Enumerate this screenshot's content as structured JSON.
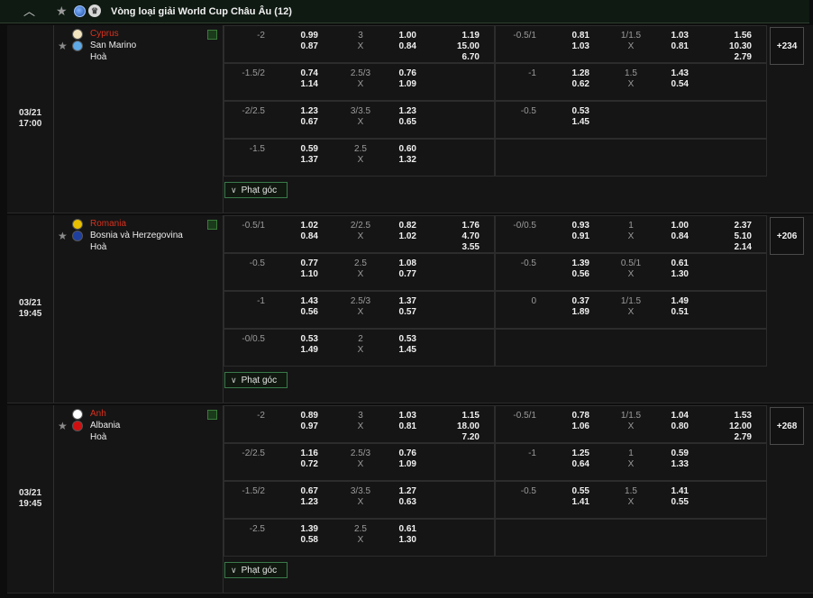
{
  "league": {
    "title": "Vòng loại giải World Cup Châu Âu (12)",
    "cup_icon": "cup-icon"
  },
  "corner_label": "Phạt góc",
  "matches": [
    {
      "date": "03/21",
      "time": "17:00",
      "home": "Cyprus",
      "away": "San Marino",
      "draw": "Hoà",
      "home_flag_color": "#f3e4c0",
      "away_flag_color": "#5fa8e6",
      "more": "+234",
      "first_1x2": [
        "1.19",
        "15.00",
        "6.70"
      ],
      "second_1x2": [
        "1.56",
        "10.30",
        "2.79"
      ],
      "rows": [
        {
          "h1": "-2",
          "o1a": "0.99",
          "o1b": "0.87",
          "t1": "3",
          "t1b": "X",
          "p1a": "1.00",
          "p1b": "0.84",
          "h2": "-0.5/1",
          "o2a": "0.81",
          "o2b": "1.03",
          "t2": "1/1.5",
          "t2b": "X",
          "p2a": "1.03",
          "p2b": "0.81"
        },
        {
          "h1": "-1.5/2",
          "o1a": "0.74",
          "o1b": "1.14",
          "t1": "2.5/3",
          "t1b": "X",
          "p1a": "0.76",
          "p1b": "1.09",
          "h2": "-1",
          "o2a": "1.28",
          "o2b": "0.62",
          "t2": "1.5",
          "t2b": "X",
          "p2a": "1.43",
          "p2b": "0.54"
        },
        {
          "h1": "-2/2.5",
          "o1a": "1.23",
          "o1b": "0.67",
          "t1": "3/3.5",
          "t1b": "X",
          "p1a": "1.23",
          "p1b": "0.65",
          "h2": "-0.5",
          "o2a": "0.53",
          "o2b": "1.45",
          "t2": "",
          "t2b": "",
          "p2a": "",
          "p2b": ""
        },
        {
          "h1": "-1.5",
          "o1a": "0.59",
          "o1b": "1.37",
          "t1": "2.5",
          "t1b": "X",
          "p1a": "0.60",
          "p1b": "1.32",
          "h2": "",
          "o2a": "",
          "o2b": "",
          "t2": "",
          "t2b": "",
          "p2a": "",
          "p2b": ""
        }
      ]
    },
    {
      "date": "03/21",
      "time": "19:45",
      "home": "Romania",
      "away": "Bosnia và Herzegovina",
      "draw": "Hoà",
      "home_flag_color": "#e8c000",
      "away_flag_color": "#1f3f9f",
      "more": "+206",
      "first_1x2": [
        "1.76",
        "4.70",
        "3.55"
      ],
      "second_1x2": [
        "2.37",
        "5.10",
        "2.14"
      ],
      "rows": [
        {
          "h1": "-0.5/1",
          "o1a": "1.02",
          "o1b": "0.84",
          "t1": "2/2.5",
          "t1b": "X",
          "p1a": "0.82",
          "p1b": "1.02",
          "h2": "-0/0.5",
          "o2a": "0.93",
          "o2b": "0.91",
          "t2": "1",
          "t2b": "X",
          "p2a": "1.00",
          "p2b": "0.84"
        },
        {
          "h1": "-0.5",
          "o1a": "0.77",
          "o1b": "1.10",
          "t1": "2.5",
          "t1b": "X",
          "p1a": "1.08",
          "p1b": "0.77",
          "h2": "-0.5",
          "o2a": "1.39",
          "o2b": "0.56",
          "t2": "0.5/1",
          "t2b": "X",
          "p2a": "0.61",
          "p2b": "1.30"
        },
        {
          "h1": "-1",
          "o1a": "1.43",
          "o1b": "0.56",
          "t1": "2.5/3",
          "t1b": "X",
          "p1a": "1.37",
          "p1b": "0.57",
          "h2": "0",
          "o2a": "0.37",
          "o2b": "1.89",
          "t2": "1/1.5",
          "t2b": "X",
          "p2a": "1.49",
          "p2b": "0.51"
        },
        {
          "h1": "-0/0.5",
          "o1a": "0.53",
          "o1b": "1.49",
          "t1": "2",
          "t1b": "X",
          "p1a": "0.53",
          "p1b": "1.45",
          "h2": "",
          "o2a": "",
          "o2b": "",
          "t2": "",
          "t2b": "",
          "p2a": "",
          "p2b": ""
        }
      ]
    },
    {
      "date": "03/21",
      "time": "19:45",
      "home": "Anh",
      "away": "Albania",
      "draw": "Hoà",
      "home_flag_color": "#ffffff",
      "away_flag_color": "#d01010",
      "more": "+268",
      "first_1x2": [
        "1.15",
        "18.00",
        "7.20"
      ],
      "second_1x2": [
        "1.53",
        "12.00",
        "2.79"
      ],
      "rows": [
        {
          "h1": "-2",
          "o1a": "0.89",
          "o1b": "0.97",
          "t1": "3",
          "t1b": "X",
          "p1a": "1.03",
          "p1b": "0.81",
          "h2": "-0.5/1",
          "o2a": "0.78",
          "o2b": "1.06",
          "t2": "1/1.5",
          "t2b": "X",
          "p2a": "1.04",
          "p2b": "0.80"
        },
        {
          "h1": "-2/2.5",
          "o1a": "1.16",
          "o1b": "0.72",
          "t1": "2.5/3",
          "t1b": "X",
          "p1a": "0.76",
          "p1b": "1.09",
          "h2": "-1",
          "o2a": "1.25",
          "o2b": "0.64",
          "t2": "1",
          "t2b": "X",
          "p2a": "0.59",
          "p2b": "1.33"
        },
        {
          "h1": "-1.5/2",
          "o1a": "0.67",
          "o1b": "1.23",
          "t1": "3/3.5",
          "t1b": "X",
          "p1a": "1.27",
          "p1b": "0.63",
          "h2": "-0.5",
          "o2a": "0.55",
          "o2b": "1.41",
          "t2": "1.5",
          "t2b": "X",
          "p2a": "1.41",
          "p2b": "0.55"
        },
        {
          "h1": "-2.5",
          "o1a": "1.39",
          "o1b": "0.58",
          "t1": "2.5",
          "t1b": "X",
          "p1a": "0.61",
          "p1b": "1.30",
          "h2": "",
          "o2a": "",
          "o2b": "",
          "t2": "",
          "t2b": "",
          "p2a": "",
          "p2b": ""
        }
      ]
    }
  ]
}
